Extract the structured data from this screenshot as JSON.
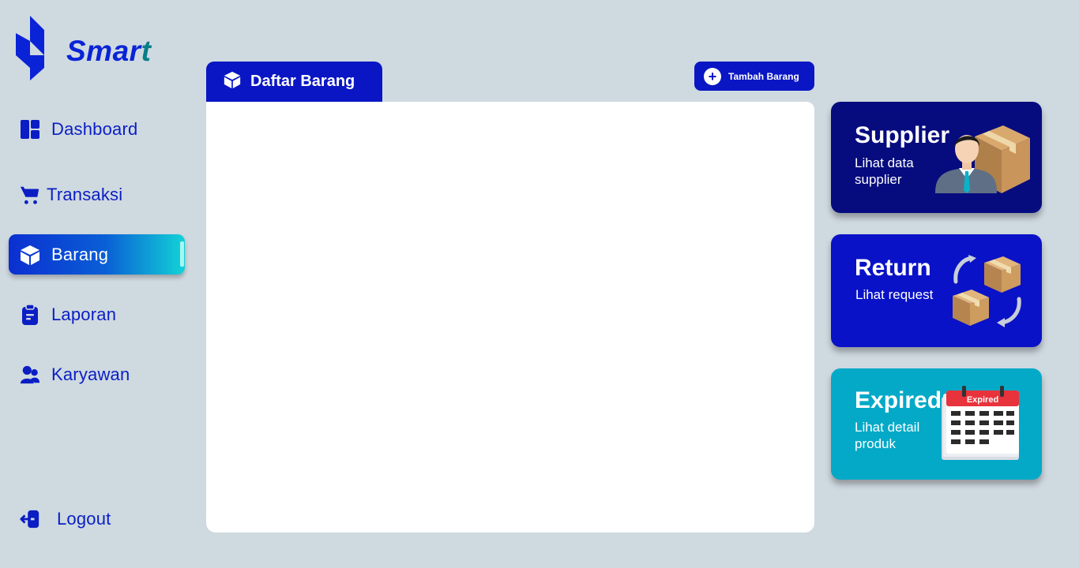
{
  "app": {
    "logo_text_main": "Smar",
    "logo_text_tail": "t",
    "brand_color": "#0b23d6"
  },
  "sidebar": {
    "items": [
      {
        "label": "Dashboard",
        "icon": "dashboard-icon",
        "active": false
      },
      {
        "label": "Transaksi",
        "icon": "cart-icon",
        "active": false
      },
      {
        "label": "Barang",
        "icon": "box-icon",
        "active": true
      },
      {
        "label": "Laporan",
        "icon": "clipboard-icon",
        "active": false
      },
      {
        "label": "Karyawan",
        "icon": "users-icon",
        "active": false
      }
    ],
    "logout_label": "Logout"
  },
  "main": {
    "tab_title": "Daftar Barang",
    "add_button_label": "Tambah Barang"
  },
  "cards": {
    "supplier": {
      "title": "Supplier",
      "desc": "Lihat data supplier"
    },
    "return": {
      "title": "Return",
      "desc": "Lihat request"
    },
    "expired": {
      "title": "Expired",
      "desc": "Lihat detail produk",
      "calendar_label": "Expired"
    }
  },
  "colors": {
    "accent": "#0a16c4",
    "supplier_card": "#060b7d",
    "return_card": "#0a12c7",
    "expired_card": "#04a9c8",
    "background": "#cfd9e0"
  }
}
